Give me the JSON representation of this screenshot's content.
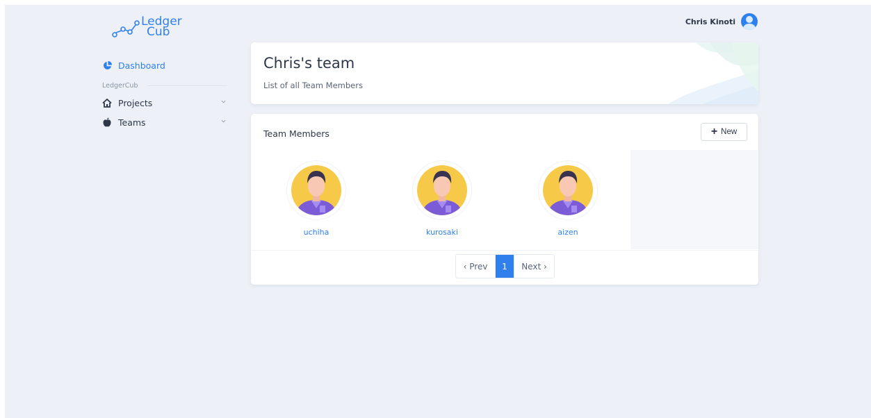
{
  "brand": {
    "line1": "Ledger",
    "line2": "Cub",
    "color": "#2f80ed"
  },
  "header": {
    "user_name": "Chris Kinoti"
  },
  "sidebar": {
    "items": [
      {
        "label": "Dashboard",
        "icon": "pie-chart-icon",
        "active": true
      }
    ],
    "section_label": "LedgerCub",
    "groups": [
      {
        "label": "Projects",
        "icon": "home-icon"
      },
      {
        "label": "Teams",
        "icon": "apple-icon"
      }
    ]
  },
  "hero": {
    "title": "Chris's team",
    "subtitle": "List of all Team Members"
  },
  "members_panel": {
    "title": "Team Members",
    "new_button_label": "New",
    "members": [
      {
        "name": "uchiha"
      },
      {
        "name": "kurosaki"
      },
      {
        "name": "aizen"
      }
    ],
    "pagination": {
      "prev": "‹ Prev",
      "current": "1",
      "next": "Next ›"
    }
  },
  "colors": {
    "accent": "#2f80ed",
    "background": "#edf1f7",
    "avatar_bg": "#f7c948",
    "avatar_shirt": "#7b5cd6"
  }
}
